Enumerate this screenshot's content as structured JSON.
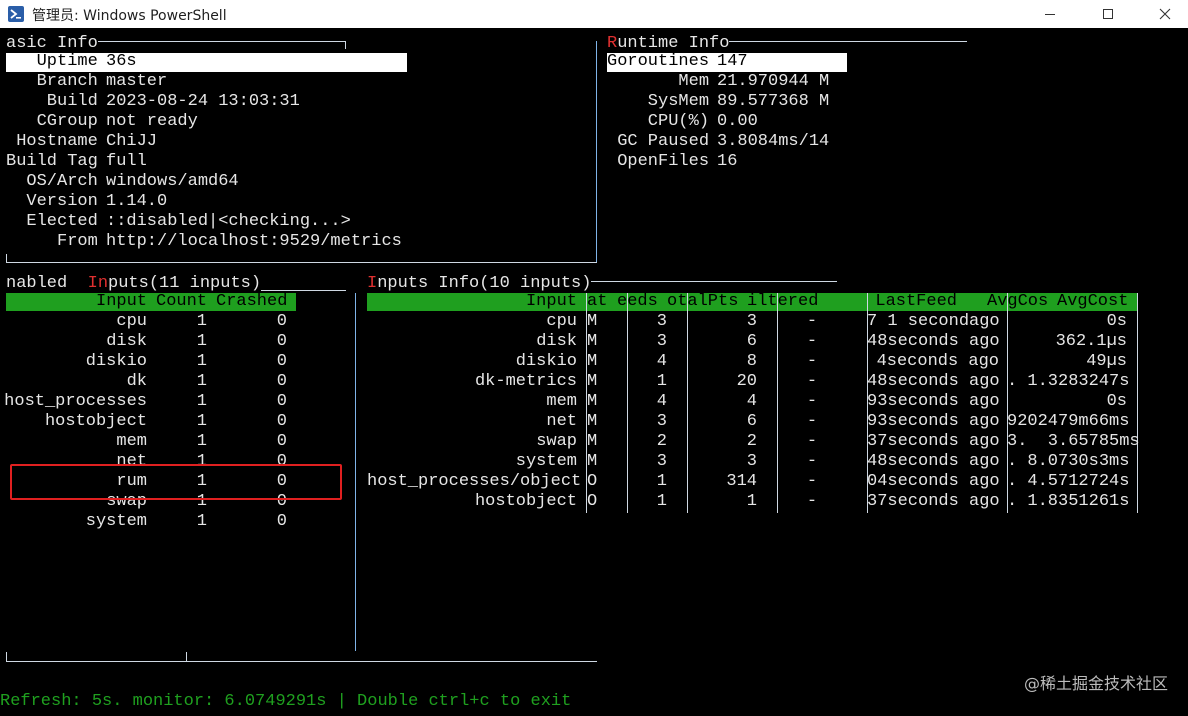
{
  "window": {
    "title": "管理员: Windows PowerShell",
    "icons": {
      "app": "powershell-icon",
      "minimize": "minimize-icon",
      "maximize": "maximize-icon",
      "close": "close-icon"
    }
  },
  "basic_info": {
    "title": "asic Info",
    "rows": [
      {
        "label": "   Uptime",
        "value": "36s"
      },
      {
        "label": "   Branch",
        "value": "master"
      },
      {
        "label": "    Build",
        "value": "2023-08-24 13:03:31"
      },
      {
        "label": "   CGroup",
        "value": "not ready"
      },
      {
        "label": " Hostname",
        "value": "ChiJJ"
      },
      {
        "label": "Build Tag",
        "value": "full"
      },
      {
        "label": "  OS/Arch",
        "value": "windows/amd64"
      },
      {
        "label": "  Version",
        "value": "1.14.0"
      },
      {
        "label": "  Elected",
        "value": "::disabled|<checking...>"
      },
      {
        "label": "     From",
        "value": "http://localhost:9529/metrics"
      }
    ]
  },
  "runtime_info": {
    "title_first": "R",
    "title_rest": "untime Info",
    "rows": [
      {
        "label": "Goroutines",
        "value": "147"
      },
      {
        "label": "       Mem",
        "value": "21.970944 M"
      },
      {
        "label": "    SysMem",
        "value": "89.577368 M"
      },
      {
        "label": "    CPU(%)",
        "value": "0.00"
      },
      {
        "label": " GC Paused",
        "value": "3.8084ms/14"
      },
      {
        "label": " OpenFiles",
        "value": "16"
      }
    ]
  },
  "enabled_inputs": {
    "title_a": "nabled  ",
    "title_b": "In",
    "title_c": "puts(11 inputs)",
    "headers": {
      "input": "Input",
      "count": "Count",
      "crashed": "Crashed"
    },
    "rows": [
      {
        "name": "cpu",
        "count": "1",
        "crashed": "0"
      },
      {
        "name": "disk",
        "count": "1",
        "crashed": "0"
      },
      {
        "name": "diskio",
        "count": "1",
        "crashed": "0"
      },
      {
        "name": "dk",
        "count": "1",
        "crashed": "0"
      },
      {
        "name": "host_processes",
        "count": "1",
        "crashed": "0"
      },
      {
        "name": "hostobject",
        "count": "1",
        "crashed": "0"
      },
      {
        "name": "mem",
        "count": "1",
        "crashed": "0"
      },
      {
        "name": "net",
        "count": "1",
        "crashed": "0"
      },
      {
        "name": "rum",
        "count": "1",
        "crashed": "0"
      },
      {
        "name": "swap",
        "count": "1",
        "crashed": "0"
      },
      {
        "name": "system",
        "count": "1",
        "crashed": "0"
      }
    ]
  },
  "inputs_info": {
    "title_first": "I",
    "title_rest": "nputs Info(10 inputs)",
    "headers": {
      "input": "Input",
      "cat": "at",
      "feeds": "eeds",
      "totalpts": "otalPts",
      "filtered": "iltered",
      "lastfeed": "LastFeed",
      "avgcos": "AvgCos",
      "avgcost": "AvgCost"
    },
    "rows": [
      {
        "input": "cpu",
        "cat": "M",
        "feeds": "3",
        "totalpts": "3",
        "filtered": "-",
        "lastfeed": "7 1 secondago",
        "avgcost": "0s"
      },
      {
        "input": "disk",
        "cat": "M",
        "feeds": "3",
        "totalpts": "6",
        "filtered": "-",
        "lastfeed": "48seconds ago",
        "avgcost": "362.1µs"
      },
      {
        "input": "diskio",
        "cat": "M",
        "feeds": "4",
        "totalpts": "8",
        "filtered": "-",
        "lastfeed": "4seconds ago",
        "avgcost": "49µs"
      },
      {
        "input": "dk-metrics",
        "cat": "M",
        "feeds": "1",
        "totalpts": "20",
        "filtered": "-",
        "lastfeed": "48seconds ago",
        "avgcost": ". 1.3283247s"
      },
      {
        "input": "mem",
        "cat": "M",
        "feeds": "4",
        "totalpts": "4",
        "filtered": "-",
        "lastfeed": "93seconds ago",
        "avgcost": "0s"
      },
      {
        "input": "net",
        "cat": "M",
        "feeds": "3",
        "totalpts": "6",
        "filtered": "-",
        "lastfeed": "93seconds ago",
        "avgcost": "9202479m66ms"
      },
      {
        "input": "swap",
        "cat": "M",
        "feeds": "2",
        "totalpts": "2",
        "filtered": "-",
        "lastfeed": "37seconds ago",
        "avgcost": "3.  3.65785ms"
      },
      {
        "input": "system",
        "cat": "M",
        "feeds": "3",
        "totalpts": "3",
        "filtered": "-",
        "lastfeed": "48seconds ago",
        "avgcost": ". 8.0730s3ms"
      },
      {
        "input": "host_processes/object",
        "cat": "O",
        "feeds": "1",
        "totalpts": "314",
        "filtered": "-",
        "lastfeed": "04seconds ago",
        "avgcost": ". 4.5712724s"
      },
      {
        "input": "hostobject",
        "cat": "O",
        "feeds": "1",
        "totalpts": "1",
        "filtered": "-",
        "lastfeed": "37seconds ago",
        "avgcost": ". 1.8351261s"
      }
    ]
  },
  "status_bar": {
    "text": "Refresh: 5s. monitor: 6.0749291s | Double ctrl+c to exit"
  },
  "watermark": "@稀土掘金技术社区",
  "colors": {
    "header_green": "#1f9f1f",
    "status_green": "#1fa01f",
    "accent_red": "#e03030",
    "annotation_red": "#e02020"
  }
}
